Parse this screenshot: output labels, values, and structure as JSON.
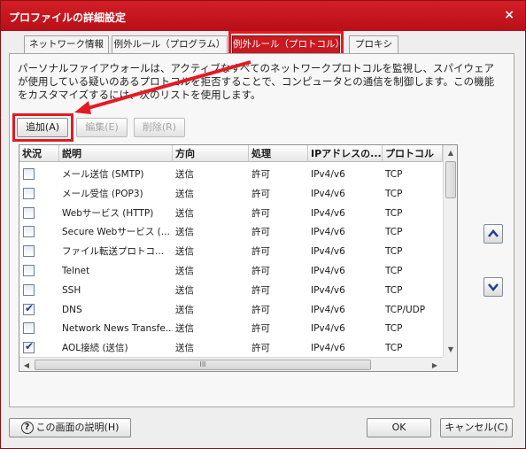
{
  "window": {
    "title": "プロファイルの詳細設定",
    "close_glyph": "×"
  },
  "tabs": [
    {
      "label": "ネットワーク情報"
    },
    {
      "label": "例外ルール（プログラム）"
    },
    {
      "label": "例外ルール（プロトコル）"
    },
    {
      "label": "プロキシ"
    }
  ],
  "description": "パーソナルファイアウォールは、アクティブなすべてのネットワークプロトコルを監視し、スパイウェアが使用している疑いのあるプロトコルを拒否することで、コンピュータとの通信を制御します。この機能をカスタマイズするには、次のリストを使用します。",
  "actions": {
    "add": "追加(A)",
    "edit": "編集(E)",
    "delete": "削除(R)"
  },
  "table": {
    "columns": [
      "状況",
      "説明",
      "方向",
      "処理",
      "IPアドレスの...",
      "プロトコル"
    ],
    "rows": [
      {
        "checked": false,
        "desc": "メール送信 (SMTP)",
        "dir": "送信",
        "action": "許可",
        "ip": "IPv4/v6",
        "proto": "TCP"
      },
      {
        "checked": false,
        "desc": "メール受信 (POP3)",
        "dir": "送信",
        "action": "許可",
        "ip": "IPv4/v6",
        "proto": "TCP"
      },
      {
        "checked": false,
        "desc": "Webサービス (HTTP)",
        "dir": "送信",
        "action": "許可",
        "ip": "IPv4/v6",
        "proto": "TCP"
      },
      {
        "checked": false,
        "desc": "Secure Webサービス (...",
        "dir": "送信",
        "action": "許可",
        "ip": "IPv4/v6",
        "proto": "TCP"
      },
      {
        "checked": false,
        "desc": "ファイル転送プロトコ...",
        "dir": "送信",
        "action": "許可",
        "ip": "IPv4/v6",
        "proto": "TCP"
      },
      {
        "checked": false,
        "desc": "Telnet",
        "dir": "送信",
        "action": "許可",
        "ip": "IPv4/v6",
        "proto": "TCP"
      },
      {
        "checked": false,
        "desc": "SSH",
        "dir": "送信",
        "action": "許可",
        "ip": "IPv4/v6",
        "proto": "TCP"
      },
      {
        "checked": true,
        "desc": "DNS",
        "dir": "送信",
        "action": "許可",
        "ip": "IPv4/v6",
        "proto": "TCP/UDP"
      },
      {
        "checked": false,
        "desc": "Network News Transfe...",
        "dir": "送信",
        "action": "許可",
        "ip": "IPv4/v6",
        "proto": "TCP"
      },
      {
        "checked": true,
        "desc": "AOL接続 (送信)",
        "dir": "送信",
        "action": "許可",
        "ip": "IPv4/v6",
        "proto": "TCP"
      }
    ],
    "hscroll_grip": "III"
  },
  "footer": {
    "help": "この画面の説明(H)",
    "help_glyph": "?",
    "ok": "OK",
    "cancel": "キャンセル(C)"
  },
  "colors": {
    "accent": "#c81a20",
    "highlight": "#e21b24"
  }
}
